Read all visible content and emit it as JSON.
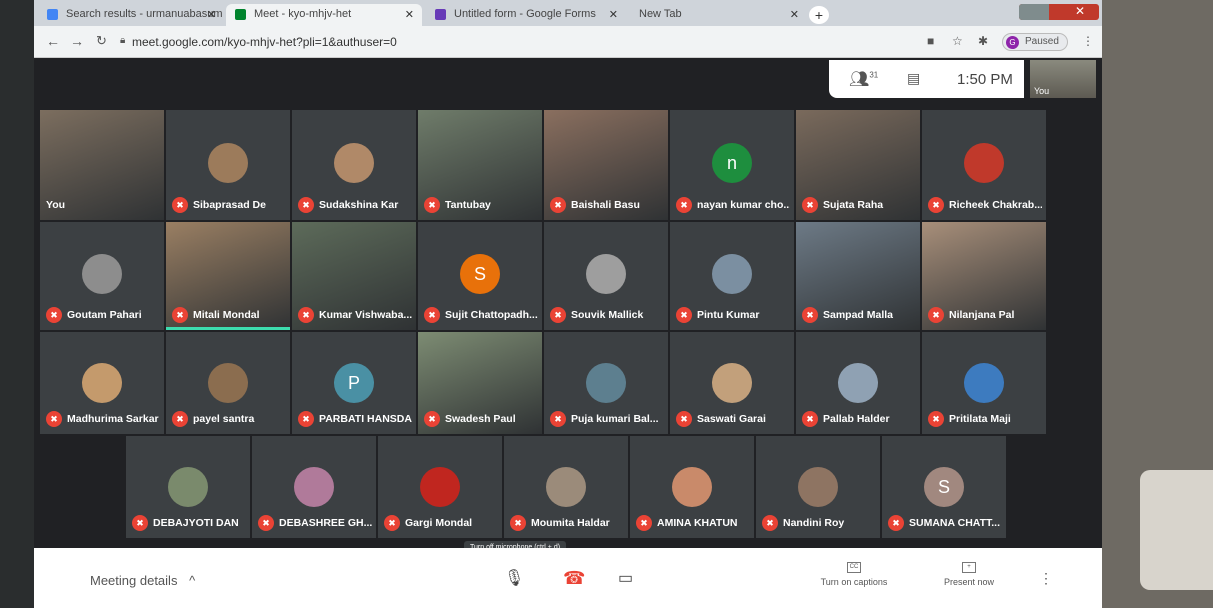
{
  "browser": {
    "tabs": [
      {
        "label": "Search results - urmanuabasum",
        "favicon_color": "#4285f4"
      },
      {
        "label": "Meet - kyo-mhjv-het",
        "favicon_color": "#00832d"
      },
      {
        "label": "Untitled form - Google Forms",
        "favicon_color": "#673ab7"
      },
      {
        "label": "New Tab",
        "favicon_color": "#cccccc"
      }
    ],
    "url": "meet.google.com/kyo-mhjv-het?pli=1&authuser=0",
    "profile_initial": "G",
    "profile_status": "Paused",
    "new_tab_glyph": "+",
    "close_glyph": "✕"
  },
  "meet_header": {
    "participant_count": "31",
    "time": "1:50 PM",
    "self_label": "You"
  },
  "participants": [
    {
      "name": "You",
      "type": "video",
      "color": "#7c6e5f"
    },
    {
      "name": "Sibaprasad De",
      "type": "avatar",
      "color": "#9c7b5b"
    },
    {
      "name": "Sudakshina Kar",
      "type": "avatar",
      "color": "#b08968"
    },
    {
      "name": "Tantubay",
      "type": "video",
      "color": "#6f7c6a"
    },
    {
      "name": "Baishali Basu",
      "type": "video",
      "color": "#8a6f5f"
    },
    {
      "name": "nayan kumar cho...",
      "type": "initial",
      "initial": "n",
      "color": "#1e8e3e"
    },
    {
      "name": "Sujata Raha",
      "type": "video",
      "color": "#7a6a5c"
    },
    {
      "name": "Richeek Chakrab...",
      "type": "avatar",
      "color": "#c0392b"
    },
    {
      "name": "Goutam Pahari",
      "type": "avatar",
      "color": "#8d8d8d"
    },
    {
      "name": "Mitali Mondal",
      "type": "video",
      "color": "#9a7f63"
    },
    {
      "name": "Kumar Vishwaba...",
      "type": "video",
      "color": "#5d6b5a"
    },
    {
      "name": "Sujit Chattopadh...",
      "type": "initial",
      "initial": "S",
      "color": "#e8710a"
    },
    {
      "name": "Souvik Mallick",
      "type": "avatar",
      "color": "#9e9e9e"
    },
    {
      "name": "Pintu Kumar",
      "type": "avatar",
      "color": "#7b8fa1"
    },
    {
      "name": "Sampad Malla",
      "type": "video",
      "color": "#6d7a86"
    },
    {
      "name": "Nilanjana Pal",
      "type": "video",
      "color": "#a88f7a"
    },
    {
      "name": "Madhurima Sarkar",
      "type": "avatar",
      "color": "#c49a6c"
    },
    {
      "name": "payel santra",
      "type": "avatar",
      "color": "#8b6d4f"
    },
    {
      "name": "PARBATI HANSDA",
      "type": "initial",
      "initial": "P",
      "color": "#4a90a4"
    },
    {
      "name": "Swadesh Paul",
      "type": "video",
      "color": "#7d8c73"
    },
    {
      "name": "Puja kumari Bal...",
      "type": "avatar",
      "color": "#5d7f8f"
    },
    {
      "name": "Saswati Garai",
      "type": "avatar",
      "color": "#c2a07b"
    },
    {
      "name": "Pallab Halder",
      "type": "avatar",
      "color": "#8fa1b3"
    },
    {
      "name": "Pritilata Maji",
      "type": "avatar",
      "color": "#3d7bbf"
    },
    {
      "name": "DEBAJYOTI DAN",
      "type": "avatar",
      "color": "#7a8a6c"
    },
    {
      "name": "DEBASHREE GH...",
      "type": "avatar",
      "color": "#b07a9a"
    },
    {
      "name": "Gargi Mondal",
      "type": "avatar",
      "color": "#c0261f"
    },
    {
      "name": "Moumita Haldar",
      "type": "avatar",
      "color": "#9b8b7a"
    },
    {
      "name": "AMINA KHATUN",
      "type": "avatar",
      "color": "#c98a6a"
    },
    {
      "name": "Nandini Roy",
      "type": "avatar",
      "color": "#8e7462"
    },
    {
      "name": "SUMANA CHATT...",
      "type": "initial",
      "initial": "S",
      "color": "#a1887f"
    }
  ],
  "bottom_bar": {
    "meeting_details": "Meeting details",
    "tooltip": "Turn off microphone (ctrl + d)",
    "captions": "Turn on captions",
    "captions_box": "CC",
    "present": "Present now",
    "present_box": "+"
  },
  "colors": {
    "mic_off": "#ea4335",
    "speaking": "#3ddcae",
    "tile_bg": "#3c4043",
    "meet_bg": "#202124"
  }
}
